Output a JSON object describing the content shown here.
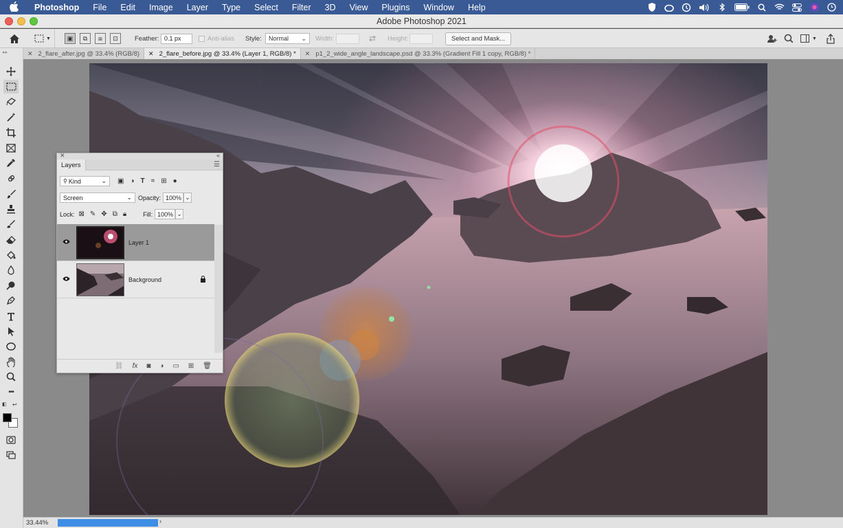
{
  "menubar": {
    "apple_icon": "",
    "app_name": "Photoshop",
    "items": [
      "File",
      "Edit",
      "Image",
      "Layer",
      "Type",
      "Select",
      "Filter",
      "3D",
      "View",
      "Plugins",
      "Window",
      "Help"
    ],
    "status_icons": [
      "shield-icon",
      "creative-cloud-icon",
      "time-machine-icon",
      "volume-icon",
      "bluetooth-icon",
      "battery-icon",
      "search-icon",
      "wifi-icon",
      "control-center-icon",
      "siri-icon",
      "clock-icon"
    ]
  },
  "window": {
    "title": "Adobe Photoshop 2021"
  },
  "options": {
    "feather_label": "Feather:",
    "feather_value": "0.1 px",
    "antialias_label": "Anti-alias",
    "style_label": "Style:",
    "style_value": "Normal",
    "width_label": "Width:",
    "height_label": "Height:",
    "select_mask_label": "Select and Mask...",
    "swap_glyph": "⇄"
  },
  "tabs": [
    {
      "label": "2_flare_after.jpg @ 33.4% (RGB/8)"
    },
    {
      "label": "2_flare_before.jpg @ 33.4% (Layer 1, RGB/8) *"
    },
    {
      "label": "p1_2_wide_angle_landscape.psd @ 33.3% (Gradient Fill 1 copy, RGB/8) *"
    }
  ],
  "tools": [
    {
      "name": "move-tool-icon",
      "glyph": "✥"
    },
    {
      "name": "marquee-tool-icon",
      "glyph": "⬚"
    },
    {
      "name": "lasso-tool-icon",
      "glyph": "ʘ"
    },
    {
      "name": "magic-wand-tool-icon",
      "glyph": "✦"
    },
    {
      "name": "crop-tool-icon",
      "glyph": "⌗"
    },
    {
      "name": "frame-tool-icon",
      "glyph": "⊠"
    },
    {
      "name": "eyedropper-tool-icon",
      "glyph": "✎"
    },
    {
      "name": "healing-brush-tool-icon",
      "glyph": "✚"
    },
    {
      "name": "brush-tool-icon",
      "glyph": "✐"
    },
    {
      "name": "stamp-tool-icon",
      "glyph": "♟"
    },
    {
      "name": "history-brush-tool-icon",
      "glyph": "✑"
    },
    {
      "name": "eraser-tool-icon",
      "glyph": "◩"
    },
    {
      "name": "paint-bucket-tool-icon",
      "glyph": "◈"
    },
    {
      "name": "blur-tool-icon",
      "glyph": "⚲"
    },
    {
      "name": "dodge-tool-icon",
      "glyph": "●"
    },
    {
      "name": "pen-tool-icon",
      "glyph": "✒"
    },
    {
      "name": "type-tool-icon",
      "glyph": "T"
    },
    {
      "name": "path-selection-tool-icon",
      "glyph": "➤"
    },
    {
      "name": "ellipse-tool-icon",
      "glyph": "◯"
    },
    {
      "name": "hand-tool-icon",
      "glyph": "✋"
    },
    {
      "name": "zoom-tool-icon",
      "glyph": "⚲"
    },
    {
      "name": "more-tools-icon",
      "glyph": "•••"
    }
  ],
  "layers_panel": {
    "title": "Layers",
    "kind_label": "Kind",
    "blend_mode": "Screen",
    "opacity_label": "Opacity:",
    "opacity_value": "100%",
    "lock_label": "Lock:",
    "fill_label": "Fill:",
    "fill_value": "100%",
    "layers": [
      {
        "name": "Layer 1",
        "visible": true,
        "selected": true,
        "locked": false
      },
      {
        "name": "Background",
        "visible": true,
        "selected": false,
        "locked": true
      }
    ]
  },
  "status": {
    "zoom": "33.44%",
    "progress": 1.0
  }
}
